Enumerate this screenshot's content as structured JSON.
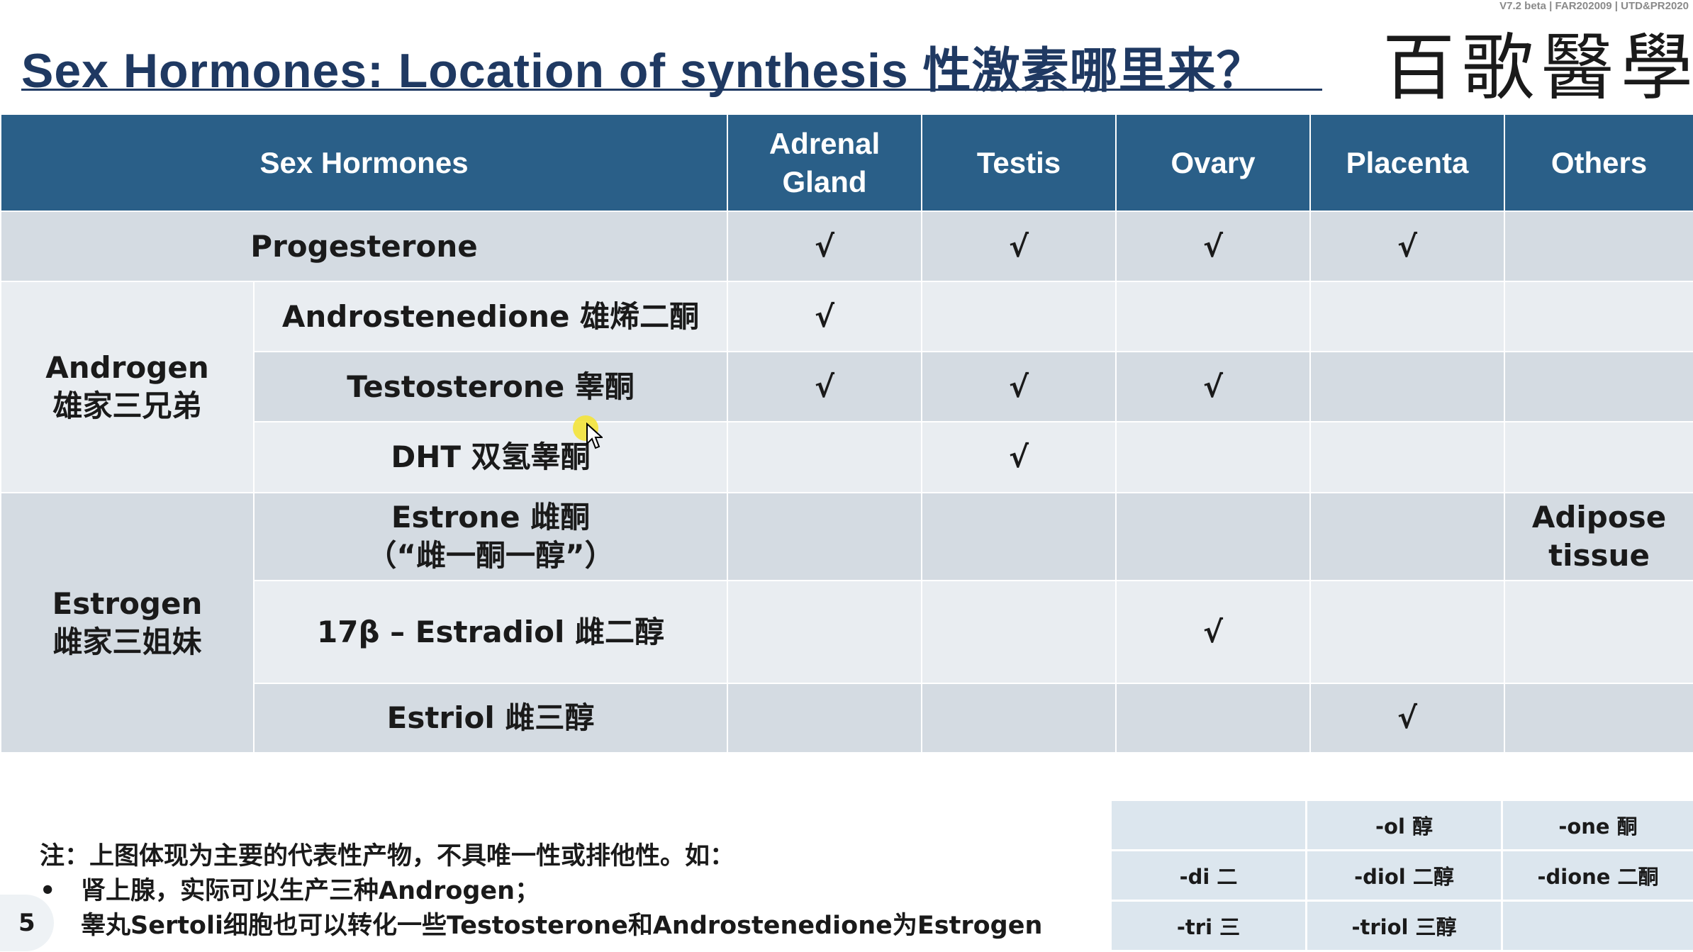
{
  "version_text": "V7.2 beta | FAR202009 | UTD&PR2020",
  "title": "Sex Hormones: Location of synthesis 性激素哪里来？",
  "logo_text": "百歌醫學",
  "table": {
    "headers": [
      "Sex Hormones",
      "Adrenal Gland",
      "Testis",
      "Ovary",
      "Placenta",
      "Others"
    ],
    "check": "√",
    "progesterone": {
      "label": "Progesterone",
      "cells": [
        "√",
        "√",
        "√",
        "√",
        ""
      ]
    },
    "androgen": {
      "group_label_en": "Androgen",
      "group_label_cn": "雄家三兄弟",
      "rows": [
        {
          "label": "Androstenedione 雄烯二酮",
          "cells": [
            "√",
            "",
            "",
            "",
            ""
          ]
        },
        {
          "label": "Testosterone 睾酮",
          "cells": [
            "√",
            "√",
            "√",
            "",
            ""
          ]
        },
        {
          "label": "DHT 双氢睾酮",
          "cells": [
            "",
            "√",
            "",
            "",
            ""
          ]
        }
      ]
    },
    "estrogen": {
      "group_label_en": "Estrogen",
      "group_label_cn": "雌家三姐妹",
      "rows": [
        {
          "label": "Estrone 雌酮",
          "sublabel": "（“雌一酮一醇”）",
          "cells": [
            "",
            "",
            "",
            "",
            ""
          ],
          "others_line1": "Adipose",
          "others_line2": "tissue"
        },
        {
          "label": "17β – Estradiol 雌二醇",
          "cells": [
            "",
            "",
            "√",
            "",
            ""
          ]
        },
        {
          "label": "Estriol 雌三醇",
          "cells": [
            "",
            "",
            "",
            "√",
            ""
          ]
        }
      ]
    }
  },
  "note": {
    "intro": "注：上图体现为主要的代表性产物，不具唯一性或排他性。如：",
    "bullets": [
      "肾上腺，实际可以生产三种Androgen；",
      "睾丸Sertoli细胞也可以转化一些Testosterone和Androstenedione为Estrogen"
    ],
    "bullet_mark": "•"
  },
  "page_number": "5",
  "suffix_table": {
    "rows": [
      [
        "",
        "-ol 醇",
        "-one 酮"
      ],
      [
        "-di 二",
        "-diol 二醇",
        "-dione 二酮"
      ],
      [
        "-tri 三",
        "-triol 三醇",
        ""
      ]
    ]
  },
  "colors": {
    "header_bg": "#2a5f88",
    "row_dark": "#d4dbe2",
    "row_light": "#e9edf1",
    "title": "#1f3962"
  }
}
